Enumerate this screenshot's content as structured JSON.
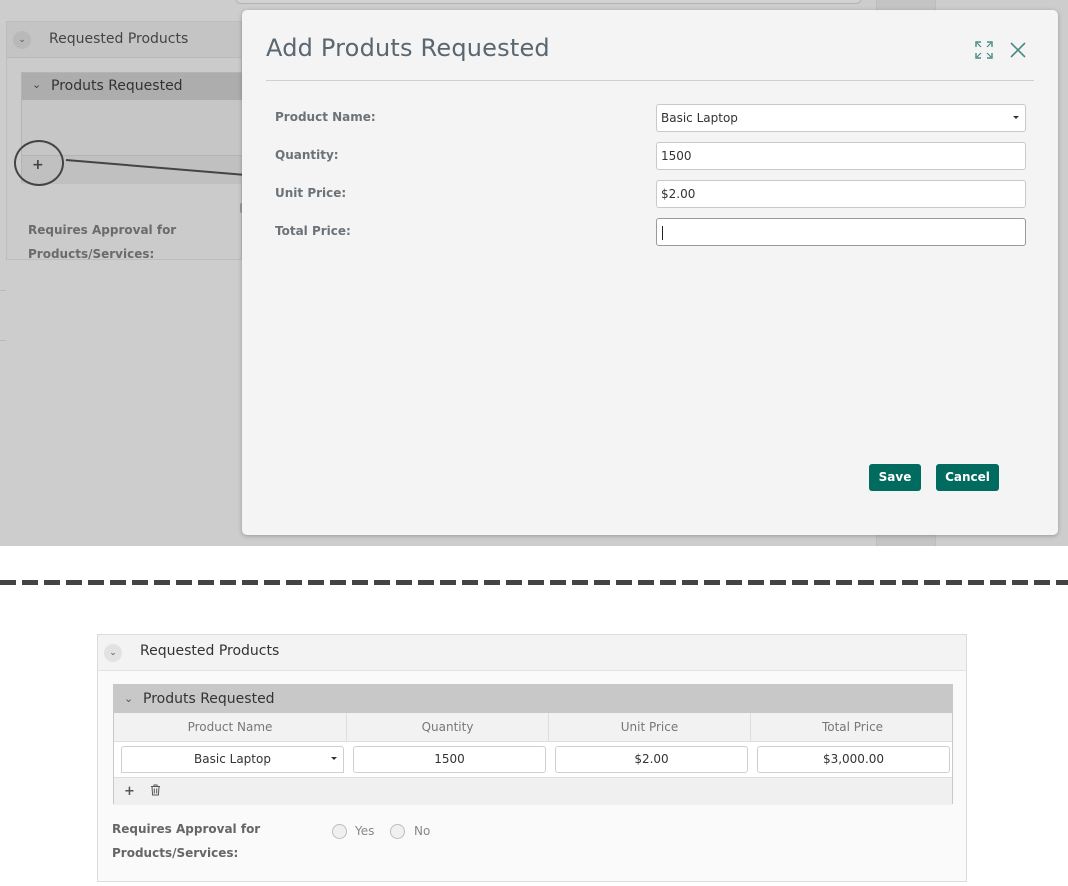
{
  "backdrop": {
    "section_title": "Requested Products",
    "subpanel_title": "Produts Requested",
    "add_glyph": "+",
    "approval_label": "Requires Approval for Products/Services:",
    "chevron_icon": "chevron-down-icon"
  },
  "modal": {
    "title": "Add Produts Requested",
    "expand_icon": "expand-icon",
    "close_icon": "close-icon",
    "fields": {
      "product_name": {
        "label": "Product Name:",
        "value": "Basic Laptop"
      },
      "quantity": {
        "label": "Quantity:",
        "value": "1500"
      },
      "unit_price": {
        "label": "Unit Price:",
        "value": "$2.00"
      },
      "total_price": {
        "label": "Total Price:",
        "value": ""
      }
    },
    "save_label": "Save",
    "cancel_label": "Cancel",
    "accent_color": "#006b5e"
  },
  "result_panel": {
    "section_title": "Requested Products",
    "subpanel_title": "Produts Requested",
    "columns": [
      "Product Name",
      "Quantity",
      "Unit Price",
      "Total Price"
    ],
    "row": {
      "product_name": "Basic Laptop",
      "quantity": "1500",
      "unit_price": "$2.00",
      "total_price": "$3,000.00"
    },
    "add_glyph": "+",
    "delete_icon": "trash-icon",
    "approval_label": "Requires Approval for Products/Services:",
    "radio_options": [
      "Yes",
      "No"
    ]
  }
}
